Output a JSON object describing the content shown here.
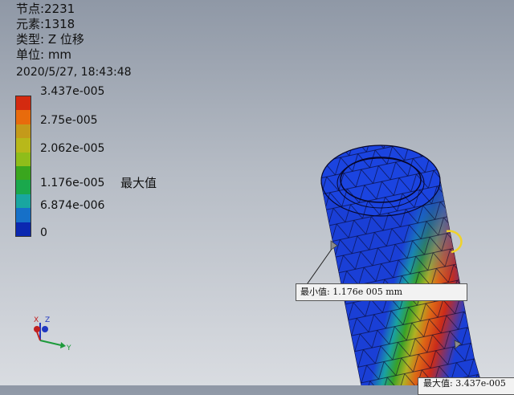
{
  "info": {
    "nodes": "节点:2231",
    "elements": "元素:1318",
    "type": "类型: Z 位移",
    "unit": "单位: mm",
    "timestamp": "2020/5/27, 18:43:48"
  },
  "legend": {
    "labels": [
      "3.437e-005",
      "2.75e-005",
      "2.062e-005",
      "1.176e-005",
      "6.874e-006",
      "0"
    ],
    "max_label": "最大值",
    "colors": [
      "#d42a10",
      "#e86b0c",
      "#c49a1a",
      "#b8b81a",
      "#8fbd1a",
      "#3aa61e",
      "#1aa84c",
      "#19a6a0",
      "#1670c8",
      "#0b28b0"
    ]
  },
  "callouts": {
    "min": "最小值: 1.176e 005 mm",
    "max": "最大值: 3.437e-005"
  },
  "axis": {
    "x": "X",
    "y": "Y",
    "z": "Z"
  },
  "model_colors": {
    "base": "#1a3fd6",
    "mesh": "#0a0a2a"
  }
}
